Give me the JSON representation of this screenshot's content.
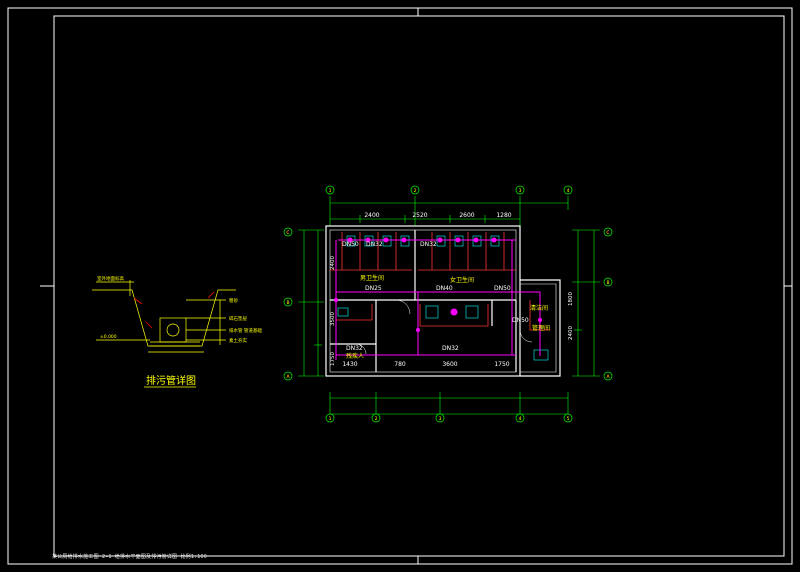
{
  "colors": {
    "background": "#000000",
    "frame": "#ffffff",
    "wall": "#ffffff",
    "dimension": "#00ff00",
    "pipe": "#ff00ff",
    "text": "#ffff00",
    "grid": "#ffff00",
    "partition": "#ff3333",
    "fixture": "#00ffff"
  },
  "detail": {
    "title": "排污管详图",
    "labels": [
      "室外地面标高",
      "粗砂",
      "碎石垫层",
      "排水管 管道基础",
      "素土夯实",
      "±0.000"
    ]
  },
  "plan": {
    "top_dims": [
      "2400",
      "2520",
      "2600",
      "1280"
    ],
    "bottom_dims": [
      "1430",
      "780",
      "3600",
      "1750"
    ],
    "left_dims": [
      "2400",
      "3500",
      "1750"
    ],
    "right_dims": [
      "1800",
      "2400"
    ],
    "grid_top": [
      "1",
      "2",
      "3",
      "4",
      "5"
    ],
    "grid_bottom": [
      "1",
      "2",
      "3",
      "4",
      "5"
    ],
    "grid_left": [
      "C",
      "B",
      "A"
    ],
    "grid_right": [
      "C",
      "B",
      "A"
    ],
    "pipes": [
      "DN50",
      "DN32",
      "DN25",
      "DN32",
      "DN40",
      "DN50",
      "DN32",
      "DN32",
      "DN50"
    ],
    "rooms": [
      "男卫生间",
      "女卫生间",
      "残疾人",
      "清洁间",
      "管理间"
    ]
  },
  "footer": "某公厕给排水施工图 2-1 给排水平面图及排污管详图 比例1:100"
}
